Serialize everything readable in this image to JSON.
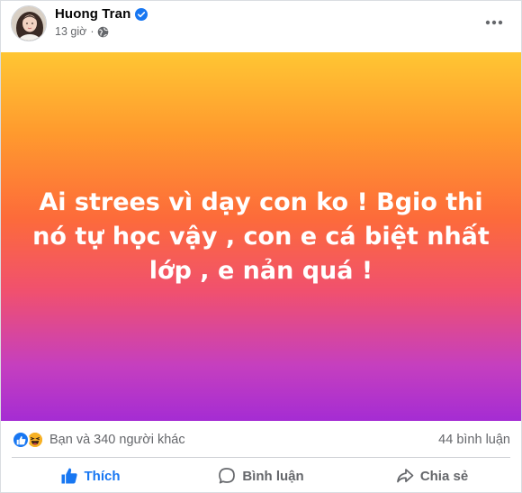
{
  "post": {
    "author": "Huong Tran",
    "time": "13 giờ",
    "separator": "·",
    "text": "Ai strees vì dạy con ko ! Bgio thi nó tự học vậy , con e cá biệt nhất lớp , e nản quá !",
    "background_gradient": [
      "#ffc633",
      "#fd6b3a",
      "#a52cd3"
    ]
  },
  "icons": {
    "verified": "verified-badge-icon",
    "privacy": "globe-icon",
    "more": "more-horizontal-icon",
    "like_reaction": "like-reaction-icon",
    "haha_reaction": "haha-reaction-icon",
    "like": "thumbs-up-icon",
    "comment": "comment-bubble-icon",
    "share": "share-arrow-icon"
  },
  "stats": {
    "reactions_text": "Bạn và 340 người khác",
    "comments_text": "44 bình luận"
  },
  "actions": {
    "like_label": "Thích",
    "comment_label": "Bình luận",
    "share_label": "Chia sẻ"
  },
  "colors": {
    "accent": "#1877f2",
    "muted_text": "#65676b",
    "haha_yellow": "#f7b125"
  }
}
